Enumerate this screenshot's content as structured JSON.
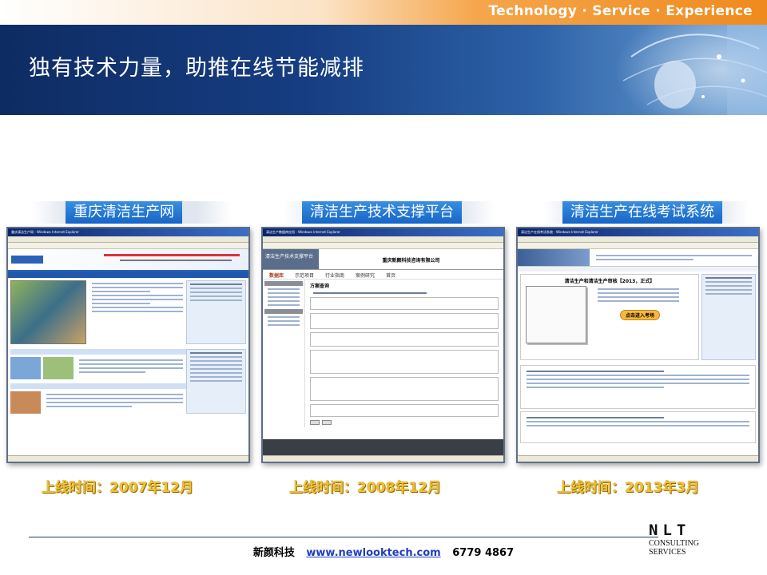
{
  "tagline": "Technology · Service · Experience",
  "title": "独有技术力量，助推在线节能减排",
  "platforms": [
    {
      "name": "重庆清洁生产网",
      "launch": "上线时间：2007年12月",
      "window_title": "重庆清洁生产网 - Windows Internet Explorer"
    },
    {
      "name": "清洁生产技术支撑平台",
      "launch": "上线时间：2008年12月",
      "window_title": "清洁生产数据库应用 - Windows Internet Explorer"
    },
    {
      "name": "清洁生产在线考试系统",
      "launch": "上线时间：2013年3月",
      "window_title": "清洁生产在线考试系统 - Windows Internet Explorer"
    }
  ],
  "shot2": {
    "header": "清洁生产技术支撑平台",
    "company": "重庆新颜科技咨询有限公司",
    "nav": [
      "数据库",
      "示范项目",
      "行业指南",
      "案例研究",
      "首页"
    ],
    "panel_title": "方案查询"
  },
  "shot3": {
    "exam_title": "清洁生产和清洁生产审核【2013，正式】",
    "enter_button": "点击进入考场"
  },
  "footer": {
    "company": "新颜科技",
    "url": "www.newlooktech.com",
    "phone": "6779 4867"
  },
  "logo": {
    "mark": "NLT",
    "line1": "CONSULTING",
    "line2": "SERVICES"
  },
  "colors": {
    "banner": "#163d82",
    "accent_orange": "#ef8a1e",
    "pill_blue": "#1565c8",
    "date_gold": "#f2c02e"
  }
}
